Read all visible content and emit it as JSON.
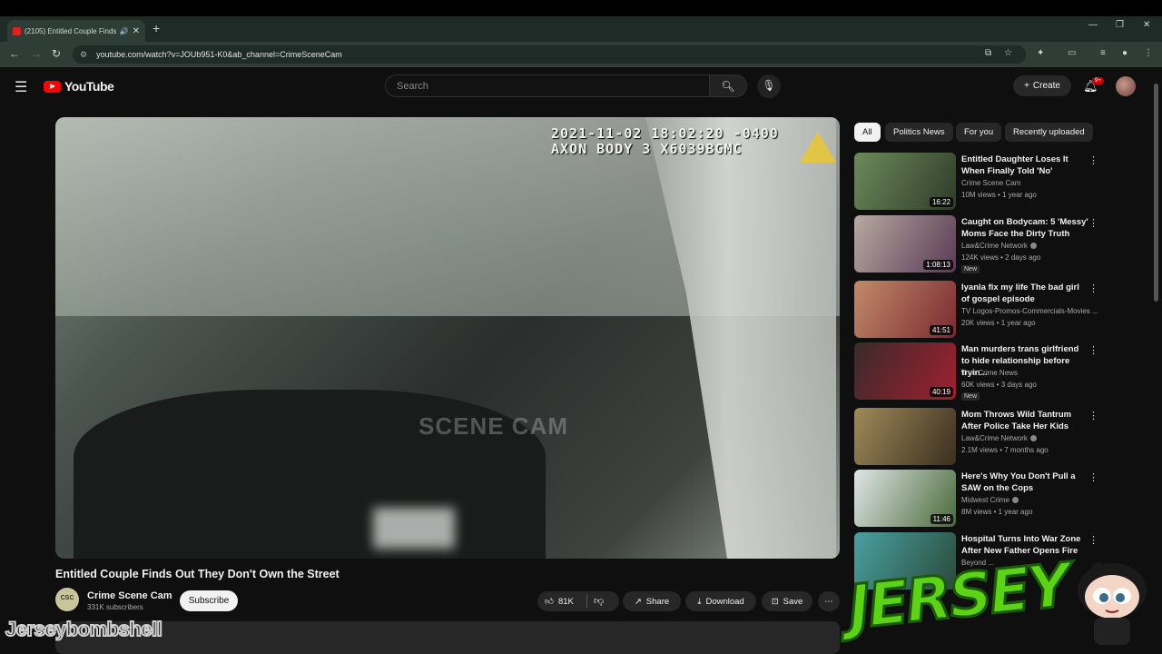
{
  "browser": {
    "tab_title": "(2105) Entitled Couple Finds",
    "url": "youtube.com/watch?v=JOUb951-K0&ab_channel=CrimeSceneCam"
  },
  "header": {
    "logo_text": "YouTube",
    "search_placeholder": "Search",
    "create_label": "Create",
    "notif_count": "9+"
  },
  "player": {
    "timestamp_line1": "2021-11-02 18:02:20 -0400",
    "timestamp_line2": "AXON BODY 3 X6039BGMC",
    "watermark": "SCENE CAM"
  },
  "video": {
    "title": "Entitled Couple Finds Out They Don't Own the Street",
    "channel": "Crime Scene Cam",
    "channel_initials": "CSC",
    "subscribers": "331K subscribers",
    "subscribe_label": "Subscribe",
    "likes": "81K",
    "share_label": "Share",
    "download_label": "Download",
    "save_label": "Save"
  },
  "chips": [
    "All",
    "Politics News",
    "For you",
    "Recently uploaded"
  ],
  "recommendations": [
    {
      "title": "Entitled Daughter Loses It When Finally Told 'No'",
      "channel": "Crime Scene Cam",
      "meta": "10M views • 1 year ago",
      "duration": "16:22",
      "verified": false,
      "new": "",
      "colors": [
        "#6c8a5a",
        "#2f3b2a"
      ]
    },
    {
      "title": "Caught on Bodycam: 5 'Messy' Moms Face the Dirty Truth",
      "channel": "Law&Crime Network",
      "meta": "124K views • 2 days ago",
      "duration": "1:08:13",
      "verified": true,
      "new": "New",
      "colors": [
        "#b7a9a0",
        "#5a3a56"
      ]
    },
    {
      "title": "Iyanla fix my life The bad girl of gospel episode",
      "channel": "TV Logos-Promos-Commercials-Movies ...",
      "meta": "20K views • 1 year ago",
      "duration": "41:51",
      "verified": false,
      "new": "",
      "colors": [
        "#c28a6a",
        "#7a2a30"
      ]
    },
    {
      "title": "Man murders trans girlfriend to hide relationship before tryin...",
      "channel": "True Crime News",
      "meta": "60K views • 3 days ago",
      "duration": "40:19",
      "verified": false,
      "new": "New",
      "colors": [
        "#3a2a2a",
        "#a02030"
      ]
    },
    {
      "title": "Mom Throws Wild Tantrum After Police Take Her Kids",
      "channel": "Law&Crime Network",
      "meta": "2.1M views • 7 months ago",
      "duration": "",
      "verified": true,
      "new": "",
      "colors": [
        "#a08a5a",
        "#3a2f1f"
      ]
    },
    {
      "title": "Here's Why You Don't Pull a SAW on the Cops",
      "channel": "Midwest Crime",
      "meta": "8M views • 1 year ago",
      "duration": "11:46",
      "verified": true,
      "new": "",
      "colors": [
        "#dfe6e6",
        "#4a6a3a"
      ]
    },
    {
      "title": "Hospital Turns Into War Zone After New Father Opens Fire",
      "channel": "Beyond ...",
      "meta": "",
      "duration": "",
      "verified": false,
      "new": "",
      "colors": [
        "#4aa0a0",
        "#2a4a3a"
      ]
    }
  ],
  "overlays": {
    "streamer_name": "Jerseybombshell",
    "jersey_logo": "JERSEY"
  }
}
